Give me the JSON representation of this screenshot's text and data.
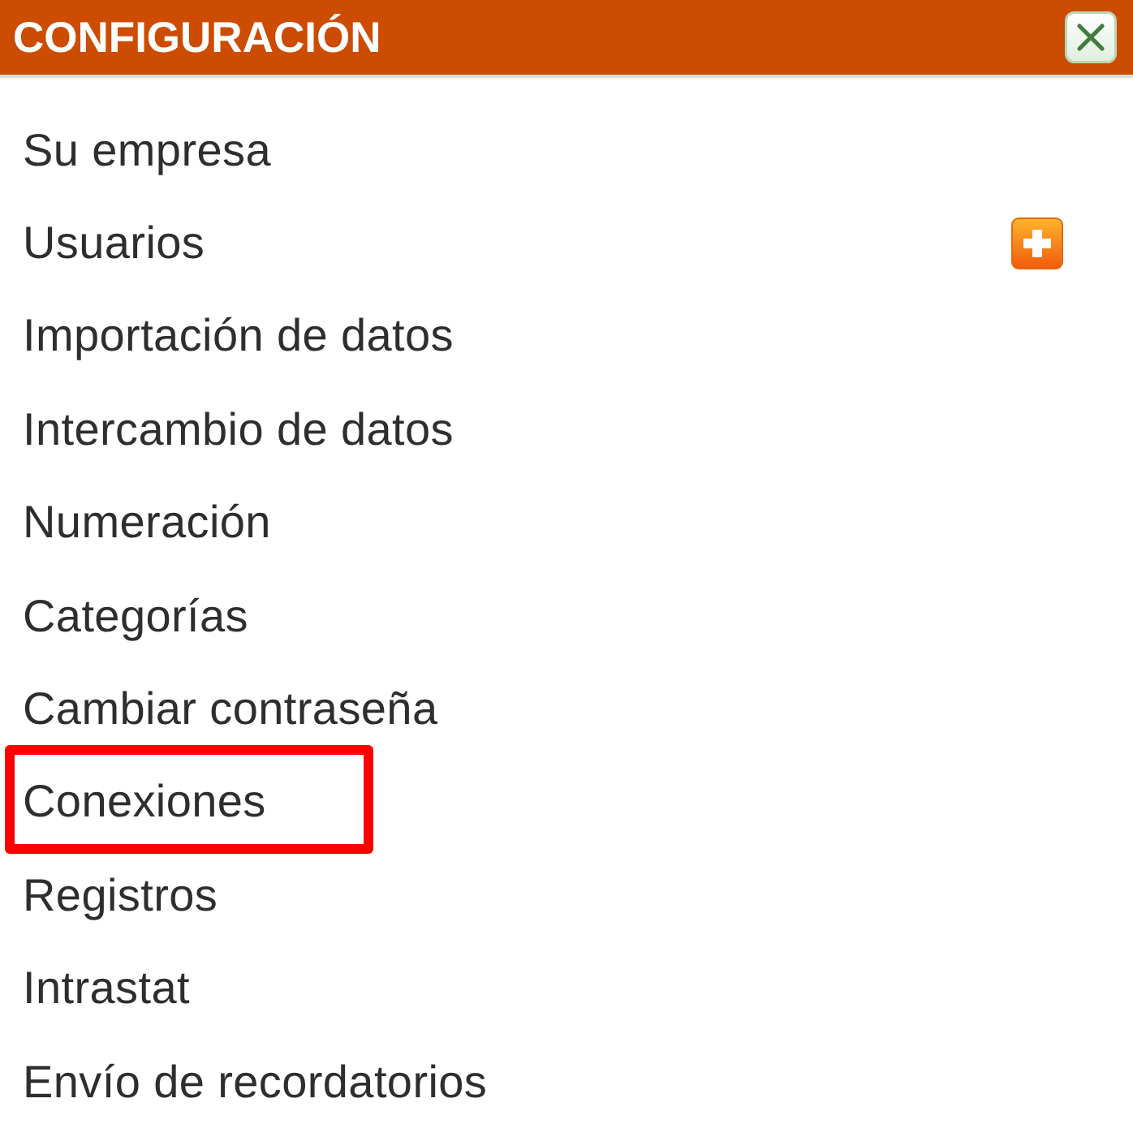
{
  "panel": {
    "title": "CONFIGURACIÓN",
    "closable": true
  },
  "items": [
    {
      "label": "Su empresa",
      "add_button": false,
      "highlighted": false
    },
    {
      "label": "Usuarios",
      "add_button": true,
      "highlighted": false
    },
    {
      "label": "Importación de datos",
      "add_button": false,
      "highlighted": false
    },
    {
      "label": "Intercambio de datos",
      "add_button": false,
      "highlighted": false
    },
    {
      "label": "Numeración",
      "add_button": false,
      "highlighted": false
    },
    {
      "label": "Categorías",
      "add_button": false,
      "highlighted": false
    },
    {
      "label": "Cambiar contraseña",
      "add_button": false,
      "highlighted": false
    },
    {
      "label": "Conexiones",
      "add_button": false,
      "highlighted": true
    },
    {
      "label": "Registros",
      "add_button": false,
      "highlighted": false
    },
    {
      "label": "Intrastat",
      "add_button": false,
      "highlighted": false
    },
    {
      "label": "Envío de recordatorios",
      "add_button": false,
      "highlighted": false
    }
  ]
}
